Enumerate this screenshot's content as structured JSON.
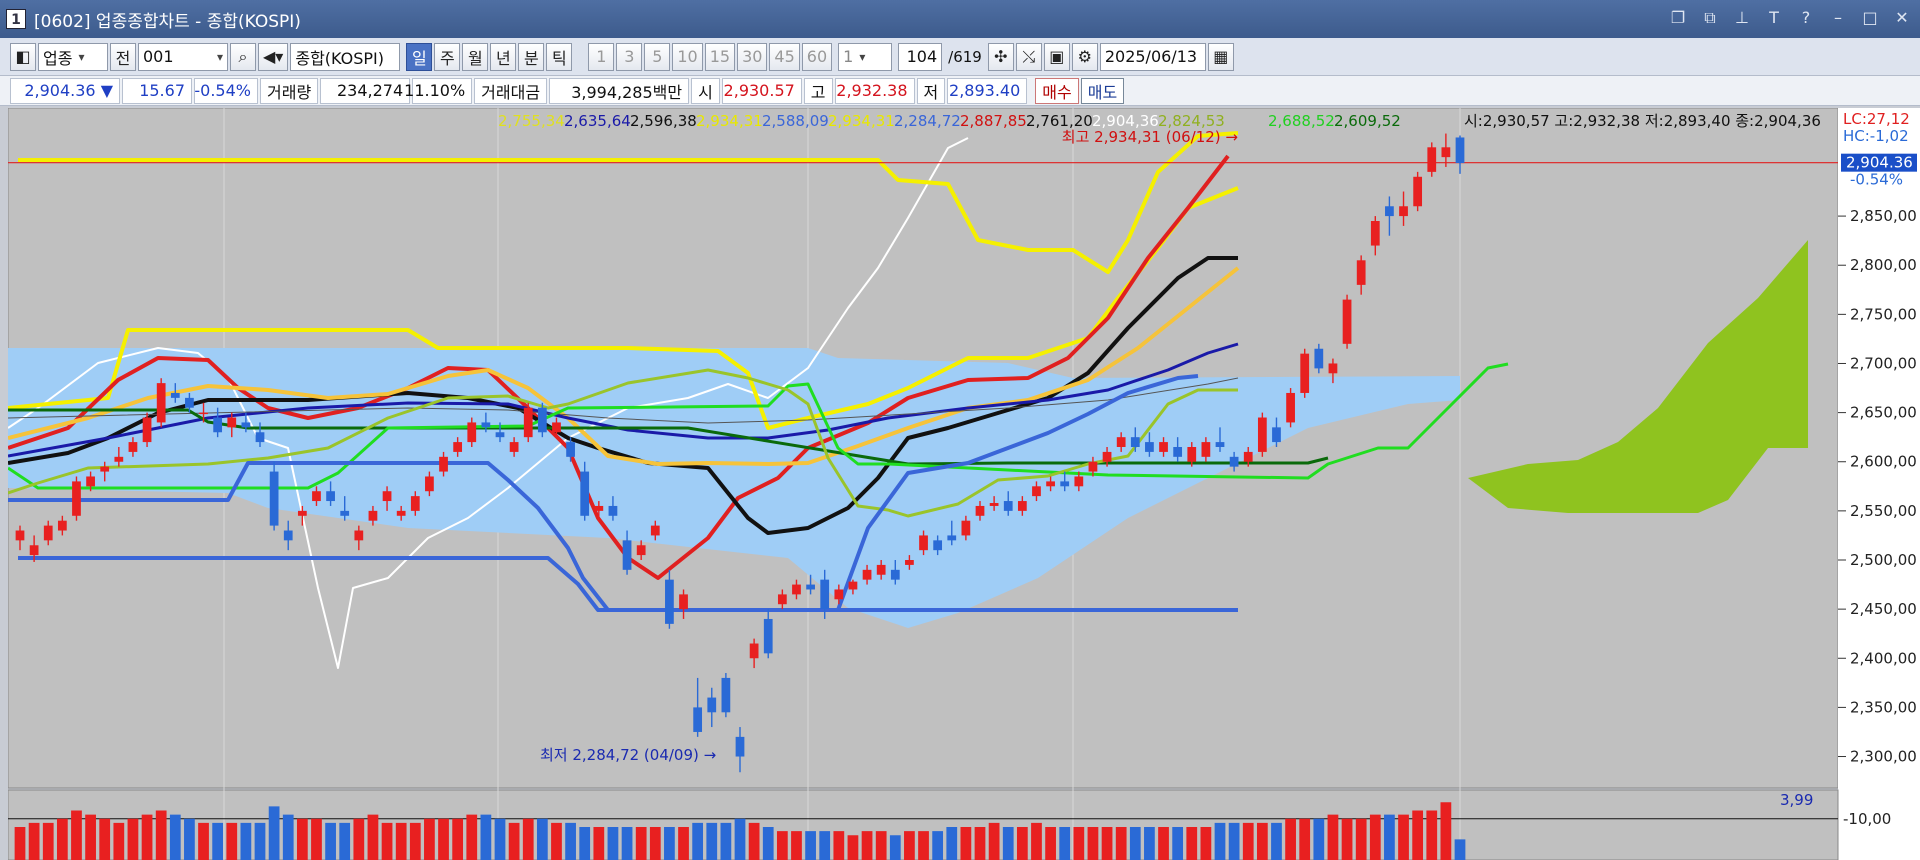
{
  "window": {
    "icon": "1",
    "title": "[0602] 업종종합차트 - 종합(KOSPI)",
    "buttons": [
      "restore-icon",
      "copy-icon",
      "pin-icon",
      "text-icon",
      "help-icon",
      "minimize-icon",
      "maximize-icon",
      "close-icon"
    ]
  },
  "toolbar": {
    "category": "업종",
    "prev": "전",
    "code": "001",
    "name": "종합(KOSPI)",
    "periods": [
      "일",
      "주",
      "월",
      "년",
      "분",
      "틱"
    ],
    "selected_period": "일",
    "intervals": [
      "1",
      "3",
      "5",
      "10",
      "15",
      "30",
      "45",
      "60"
    ],
    "count": "1",
    "page": "104",
    "total": "/619",
    "date": "2025/06/13"
  },
  "quote": {
    "price": "2,904.36 ▼",
    "change": "15.67",
    "change_pct": "-0.54%",
    "volume_label": "거래량",
    "volume": "234,274",
    "volume_pct": "11.10%",
    "amount_label": "거래대금",
    "amount": "3,994,285백만",
    "open_label": "시",
    "open": "2,930.57",
    "high_label": "고",
    "high": "2,932.38",
    "low_label": "저",
    "low": "2,893.40",
    "buy": "매수",
    "sell": "매도"
  },
  "chart_data": {
    "type": "candlestick",
    "ylim": [
      2270,
      2960
    ],
    "yticks": [
      "2,300,00",
      "2,350,00",
      "2,400,00",
      "2,450,00",
      "2,500,00",
      "2,550,00",
      "2,600,00",
      "2,650,00",
      "2,700,00",
      "2,750,00",
      "2,800,00",
      "2,850,00"
    ],
    "ytick_values": [
      2300,
      2350,
      2400,
      2450,
      2500,
      2550,
      2600,
      2650,
      2700,
      2750,
      2800,
      2850
    ],
    "current_price": "2,904.36",
    "current_pct": "-0.54%",
    "current_value": 2904.36,
    "lc": "LC:27,12",
    "hc": "HC:-1,02",
    "ohlc_text": "시:2,930,57 고:2,932,38 저:2,893,40 종:2,904,36",
    "max_label": "최고 2,934,31 (06/12) →",
    "min_label": "최저 2,284,72 (04/09) →",
    "legend": [
      {
        "text": "2,755,34",
        "color": "#e0e020"
      },
      {
        "text": "2,635,64",
        "color": "#1a1aa8"
      },
      {
        "text": "2,596,38",
        "color": "#111111"
      },
      {
        "text": "2,934,31",
        "color": "#e8e800"
      },
      {
        "text": "2,588,09",
        "color": "#3a66d8"
      },
      {
        "text": "2,934,31",
        "color": "#e8e800"
      },
      {
        "text": "2,284,72",
        "color": "#3a66d8"
      },
      {
        "text": "2,887,85",
        "color": "#d01010"
      },
      {
        "text": "2,761,20",
        "color": "#111111"
      },
      {
        "text": "2,904,36",
        "color": "#ffffff"
      },
      {
        "text": "2,824,53",
        "color": "#90b020"
      },
      {
        "text": "2,688,52",
        "color": "#20d020"
      },
      {
        "text": "2,609,52",
        "color": "#0a6a0a"
      }
    ],
    "candles": [
      [
        2520,
        2535,
        2510,
        2530
      ],
      [
        2505,
        2525,
        2498,
        2515
      ],
      [
        2520,
        2540,
        2515,
        2535
      ],
      [
        2530,
        2545,
        2525,
        2540
      ],
      [
        2545,
        2585,
        2540,
        2580
      ],
      [
        2575,
        2590,
        2570,
        2585
      ],
      [
        2590,
        2600,
        2580,
        2595
      ],
      [
        2600,
        2615,
        2595,
        2605
      ],
      [
        2610,
        2625,
        2605,
        2620
      ],
      [
        2620,
        2650,
        2615,
        2645
      ],
      [
        2640,
        2685,
        2635,
        2680
      ],
      [
        2670,
        2680,
        2660,
        2665
      ],
      [
        2665,
        2670,
        2650,
        2655
      ],
      [
        2650,
        2660,
        2640,
        2650
      ],
      [
        2645,
        2655,
        2625,
        2630
      ],
      [
        2635,
        2650,
        2625,
        2645
      ],
      [
        2640,
        2650,
        2630,
        2635
      ],
      [
        2630,
        2640,
        2615,
        2620
      ],
      [
        2590,
        2600,
        2530,
        2535
      ],
      [
        2530,
        2540,
        2510,
        2520
      ],
      [
        2545,
        2555,
        2535,
        2550
      ],
      [
        2560,
        2575,
        2555,
        2570
      ],
      [
        2570,
        2580,
        2555,
        2560
      ],
      [
        2550,
        2565,
        2540,
        2545
      ],
      [
        2520,
        2535,
        2510,
        2530
      ],
      [
        2540,
        2555,
        2535,
        2550
      ],
      [
        2560,
        2575,
        2550,
        2570
      ],
      [
        2545,
        2555,
        2540,
        2550
      ],
      [
        2550,
        2570,
        2545,
        2565
      ],
      [
        2570,
        2590,
        2565,
        2585
      ],
      [
        2590,
        2610,
        2585,
        2605
      ],
      [
        2610,
        2625,
        2605,
        2620
      ],
      [
        2620,
        2645,
        2615,
        2640
      ],
      [
        2640,
        2650,
        2630,
        2635
      ],
      [
        2630,
        2640,
        2620,
        2625
      ],
      [
        2610,
        2625,
        2605,
        2620
      ],
      [
        2625,
        2660,
        2620,
        2655
      ],
      [
        2655,
        2660,
        2625,
        2630
      ],
      [
        2630,
        2645,
        2625,
        2640
      ],
      [
        2620,
        2625,
        2600,
        2605
      ],
      [
        2590,
        2600,
        2540,
        2545
      ],
      [
        2550,
        2560,
        2540,
        2555
      ],
      [
        2555,
        2565,
        2540,
        2545
      ],
      [
        2520,
        2530,
        2485,
        2490
      ],
      [
        2505,
        2520,
        2500,
        2515
      ],
      [
        2525,
        2540,
        2520,
        2535
      ],
      [
        2480,
        2490,
        2430,
        2435
      ],
      [
        2450,
        2470,
        2440,
        2465
      ],
      [
        2350,
        2380,
        2320,
        2325
      ],
      [
        2360,
        2370,
        2330,
        2345
      ],
      [
        2380,
        2385,
        2340,
        2345
      ],
      [
        2320,
        2330,
        2284,
        2300
      ],
      [
        2400,
        2420,
        2390,
        2415
      ],
      [
        2440,
        2450,
        2400,
        2405
      ],
      [
        2455,
        2470,
        2450,
        2465
      ],
      [
        2465,
        2480,
        2460,
        2475
      ],
      [
        2475,
        2485,
        2465,
        2470
      ],
      [
        2480,
        2490,
        2440,
        2450
      ],
      [
        2460,
        2475,
        2455,
        2470
      ],
      [
        2470,
        2480,
        2465,
        2478
      ],
      [
        2480,
        2495,
        2475,
        2490
      ],
      [
        2485,
        2500,
        2480,
        2495
      ],
      [
        2490,
        2500,
        2475,
        2480
      ],
      [
        2495,
        2505,
        2490,
        2500
      ],
      [
        2510,
        2530,
        2505,
        2525
      ],
      [
        2520,
        2525,
        2505,
        2510
      ],
      [
        2525,
        2540,
        2515,
        2520
      ],
      [
        2525,
        2545,
        2520,
        2540
      ],
      [
        2545,
        2560,
        2540,
        2555
      ],
      [
        2555,
        2565,
        2550,
        2558
      ],
      [
        2560,
        2570,
        2545,
        2550
      ],
      [
        2550,
        2565,
        2545,
        2560
      ],
      [
        2565,
        2580,
        2560,
        2575
      ],
      [
        2575,
        2585,
        2570,
        2580
      ],
      [
        2580,
        2590,
        2570,
        2575
      ],
      [
        2575,
        2590,
        2570,
        2585
      ],
      [
        2590,
        2605,
        2585,
        2600
      ],
      [
        2600,
        2615,
        2595,
        2610
      ],
      [
        2615,
        2630,
        2610,
        2625
      ],
      [
        2625,
        2635,
        2610,
        2615
      ],
      [
        2620,
        2630,
        2605,
        2610
      ],
      [
        2610,
        2625,
        2605,
        2620
      ],
      [
        2615,
        2625,
        2600,
        2605
      ],
      [
        2600,
        2620,
        2595,
        2615
      ],
      [
        2605,
        2625,
        2600,
        2620
      ],
      [
        2620,
        2635,
        2610,
        2615
      ],
      [
        2605,
        2610,
        2590,
        2595
      ],
      [
        2600,
        2615,
        2595,
        2610
      ],
      [
        2610,
        2650,
        2605,
        2645
      ],
      [
        2635,
        2645,
        2615,
        2620
      ],
      [
        2640,
        2675,
        2635,
        2670
      ],
      [
        2670,
        2715,
        2665,
        2710
      ],
      [
        2715,
        2720,
        2690,
        2695
      ],
      [
        2690,
        2705,
        2680,
        2700
      ],
      [
        2720,
        2770,
        2715,
        2765
      ],
      [
        2780,
        2810,
        2770,
        2805
      ],
      [
        2820,
        2850,
        2810,
        2845
      ],
      [
        2860,
        2870,
        2830,
        2850
      ],
      [
        2850,
        2875,
        2840,
        2860
      ],
      [
        2860,
        2895,
        2855,
        2890
      ],
      [
        2895,
        2925,
        2890,
        2920
      ],
      [
        2910,
        2934,
        2900,
        2920
      ],
      [
        2930,
        2932,
        2893,
        2904
      ]
    ],
    "volume_label": "3,99",
    "volume_tick": "-10,00",
    "volume_tick_value": 10,
    "volume_ylim": [
      0,
      16
    ],
    "volumes": [
      8,
      9,
      9,
      10,
      12,
      11,
      10,
      9,
      10,
      11,
      12,
      11,
      10,
      9,
      9,
      9,
      9,
      9,
      13,
      11,
      10,
      10,
      9,
      9,
      10,
      11,
      9,
      9,
      9,
      10,
      10,
      10,
      11,
      11,
      10,
      9,
      10,
      10,
      9,
      9,
      8,
      8,
      8,
      8,
      8,
      8,
      8,
      8,
      9,
      9,
      9,
      10,
      9,
      8,
      7,
      7,
      7,
      7,
      7,
      6,
      7,
      7,
      6,
      7,
      7,
      7,
      8,
      8,
      8,
      9,
      8,
      8,
      9,
      8,
      8,
      8,
      8,
      8,
      8,
      8,
      8,
      8,
      8,
      8,
      8,
      9,
      9,
      9,
      9,
      9,
      10,
      10,
      10,
      11,
      10,
      10,
      11,
      11,
      11,
      12,
      12,
      14,
      5
    ]
  }
}
